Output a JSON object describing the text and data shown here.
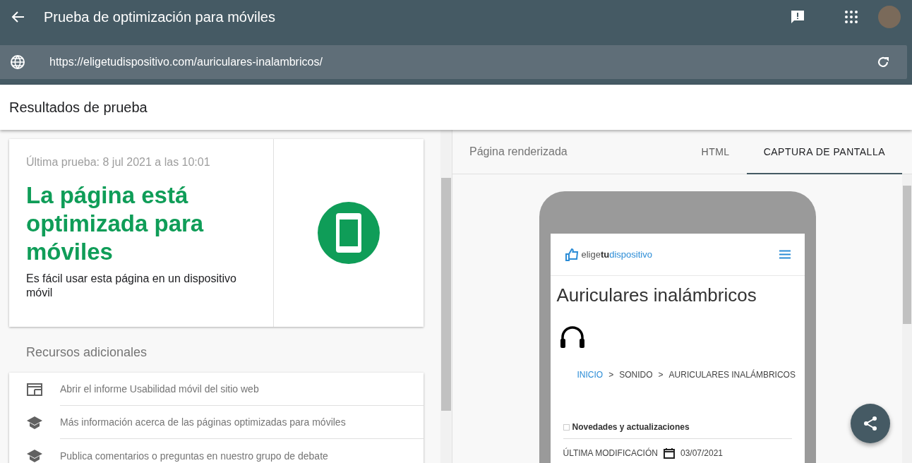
{
  "app_bar": {
    "title": "Prueba de optimización para móviles"
  },
  "url_bar": {
    "value": "https://eligetudispositivo.com/auriculares-inalambricos/"
  },
  "results_header": "Resultados de prueba",
  "result_card": {
    "last_test": "Última prueba: 8 jul 2021 a las 10:01",
    "verdict": "La página está optimizada para móviles",
    "detail": "Es fácil usar esta página en un dispositivo móvil",
    "passed": true
  },
  "resources": {
    "title": "Recursos adicionales",
    "items": [
      {
        "kind": "report",
        "label": "Abrir el informe Usabilidad móvil del sitio web"
      },
      {
        "kind": "learn",
        "label": "Más información acerca de las páginas optimizadas para móviles"
      },
      {
        "kind": "learn",
        "label": "Publica comentarios o preguntas en nuestro grupo de debate"
      }
    ]
  },
  "preview": {
    "title": "Página renderizada",
    "tabs": [
      {
        "label": "HTML",
        "selected": false
      },
      {
        "label": "CAPTURA DE PANTALLA",
        "selected": true
      }
    ],
    "site": {
      "logo": [
        {
          "kind": "plain",
          "text": "elige"
        },
        {
          "kind": "strong",
          "text": "tu"
        },
        {
          "kind": "accent",
          "text": "dispositivo"
        }
      ],
      "heading": "Auriculares inalámbricos",
      "breadcrumb": [
        {
          "label": "INICIO",
          "link": true
        },
        {
          "label": ">",
          "link": false
        },
        {
          "label": "SONIDO",
          "link": false
        },
        {
          "label": ">",
          "link": false
        },
        {
          "label": "AURICULARES INALÁMBRICOS",
          "link": false
        }
      ],
      "section": "Novedades y actualizaciones",
      "modified_label": "ÚLTIMA MODIFICACIÓN",
      "modified_date": "03/07/2021"
    }
  }
}
